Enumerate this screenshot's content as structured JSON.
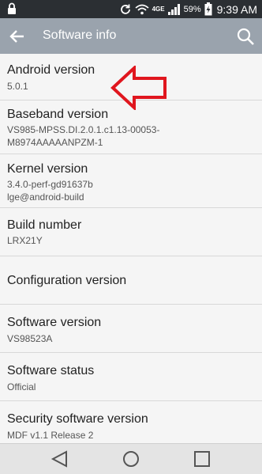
{
  "status_bar": {
    "network": "4GE",
    "battery_percent": "59%",
    "time": "9:39 AM"
  },
  "app_bar": {
    "title": "Software info"
  },
  "items": [
    {
      "title": "Android version",
      "value": "5.0.1"
    },
    {
      "title": "Baseband version",
      "value": "VS985-MPSS.DI.2.0.1.c1.13-00053-",
      "value2": "M8974AAAAANPZM-1"
    },
    {
      "title": "Kernel version",
      "value": "3.4.0-perf-gd91637b",
      "value2": "lge@android-build"
    },
    {
      "title": "Build number",
      "value": "LRX21Y"
    },
    {
      "title": "Configuration version"
    },
    {
      "title": "Software version",
      "value": "VS98523A"
    },
    {
      "title": "Software status",
      "value": "Official"
    },
    {
      "title": "Security software version",
      "value": "MDF v1.1 Release 2"
    }
  ],
  "colors": {
    "status_bar": "#2b2f33",
    "app_bar": "#9aa3ad",
    "annotation_arrow": "#e0161e"
  }
}
